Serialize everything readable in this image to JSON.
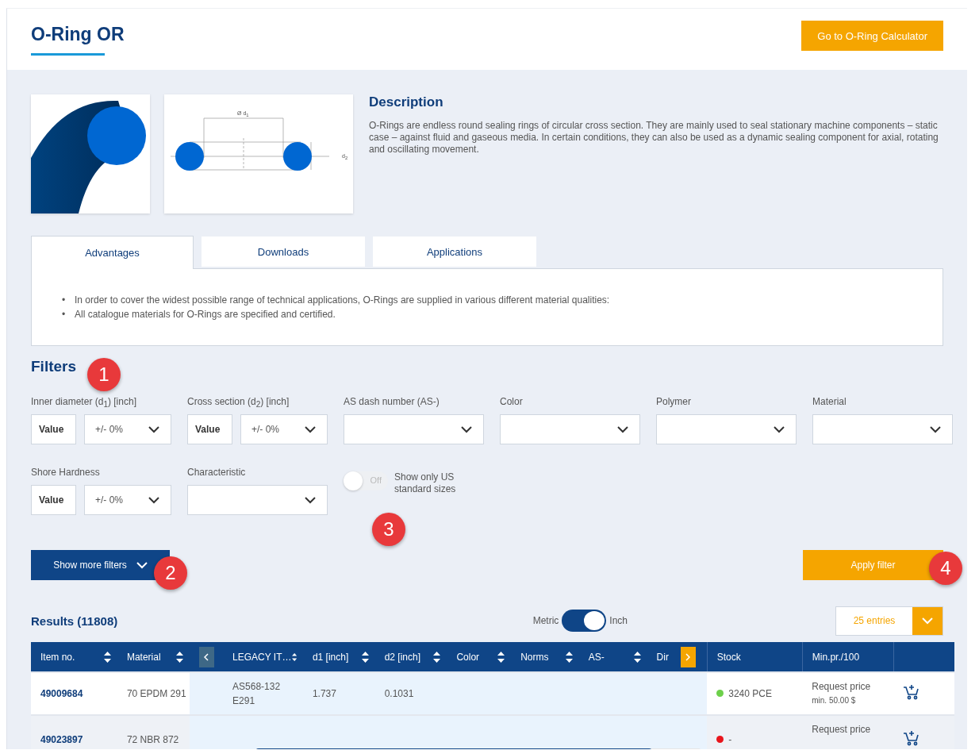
{
  "header": {
    "title": "O-Ring OR",
    "calculator_button": "Go to O-Ring Calculator"
  },
  "product": {
    "diagram_labels": [
      "Ø d$_{1}$",
      "d$_{2}$"
    ],
    "description_title": "Description",
    "description": "O-Rings are endless round sealing rings of circular cross section. They are mainly used to seal stationary machine components – static case – against fluid and gaseous media. In certain conditions, they can also be used as a dynamic sealing component for axial, rotating and oscillating movement."
  },
  "tabs": [
    {
      "label": "Advantages",
      "selected": true
    },
    {
      "label": "Downloads",
      "selected": false
    },
    {
      "label": "Applications",
      "selected": false
    }
  ],
  "advantages": {
    "marker": "•",
    "items": [
      "In order to cover the widest possible range of technical applications, O-Rings are supplied in various different material qualities:",
      "All catalogue materials for O-Rings are specified and certified."
    ]
  },
  "filters": {
    "title": "Filters",
    "items": [
      {
        "kind": "range",
        "label": "Inner diameter (d$_{1}$) [inch]",
        "placeholder": "Value",
        "tolerance": "+/- 0%"
      },
      {
        "kind": "range",
        "label": "Cross section (d$_{2}$) [inch]",
        "placeholder": "Value",
        "tolerance": "+/- 0%"
      },
      {
        "kind": "select",
        "label": "AS dash number (AS-)"
      },
      {
        "kind": "select",
        "label": "Color"
      },
      {
        "kind": "select",
        "label": "Polymer"
      },
      {
        "kind": "select",
        "label": "Material"
      },
      {
        "kind": "range",
        "label": "Shore Hardness",
        "placeholder": "Value",
        "tolerance": "+/- 0%"
      },
      {
        "kind": "select",
        "label": "Characteristic"
      },
      {
        "kind": "switch",
        "label": "Show only US standard sizes",
        "state_label": "Off",
        "on": false
      }
    ],
    "more_button": "Show more filters",
    "apply_button": "Apply filter"
  },
  "results": {
    "title": "Results (11808)",
    "unit_toggle": {
      "left_label": "Metric",
      "right_label": "Inch",
      "on": true
    },
    "entries": "25 entries",
    "columns_fixed": [
      {
        "label": "Item no.",
        "sortable": true
      },
      {
        "label": "Material",
        "sortable": true
      }
    ],
    "columns_scroll": [
      {
        "label": "LEGACY IT…",
        "sortable": true
      },
      {
        "label": "d1 [inch]",
        "sortable": true
      },
      {
        "label": "d2 [inch]",
        "sortable": true
      },
      {
        "label": "Color",
        "sortable": true
      },
      {
        "label": "Norms",
        "sortable": true
      },
      {
        "label": "AS-",
        "sortable": true
      },
      {
        "label": "Dir",
        "sortable": false
      }
    ],
    "columns_right": [
      "Stock",
      "Min.pr./100"
    ],
    "rows": [
      {
        "item": "49009684",
        "material": "70 EPDM 291",
        "cells": [
          "AS568-132 E291",
          "1.737",
          "0.1031",
          "",
          "",
          "",
          ""
        ],
        "stock": "3240 PCE",
        "color": "#6dd04a",
        "price": "Request price",
        "min": "min. 50.00 $"
      },
      {
        "item": "49023897",
        "material": "72 NBR 872",
        "cells": [
          "",
          "",
          "",
          "",
          "",
          "",
          ""
        ],
        "stock": "-",
        "color": "#e8141b",
        "price": "Request price",
        "min": ""
      }
    ]
  },
  "callouts": [
    "1",
    "2",
    "3",
    "4"
  ]
}
